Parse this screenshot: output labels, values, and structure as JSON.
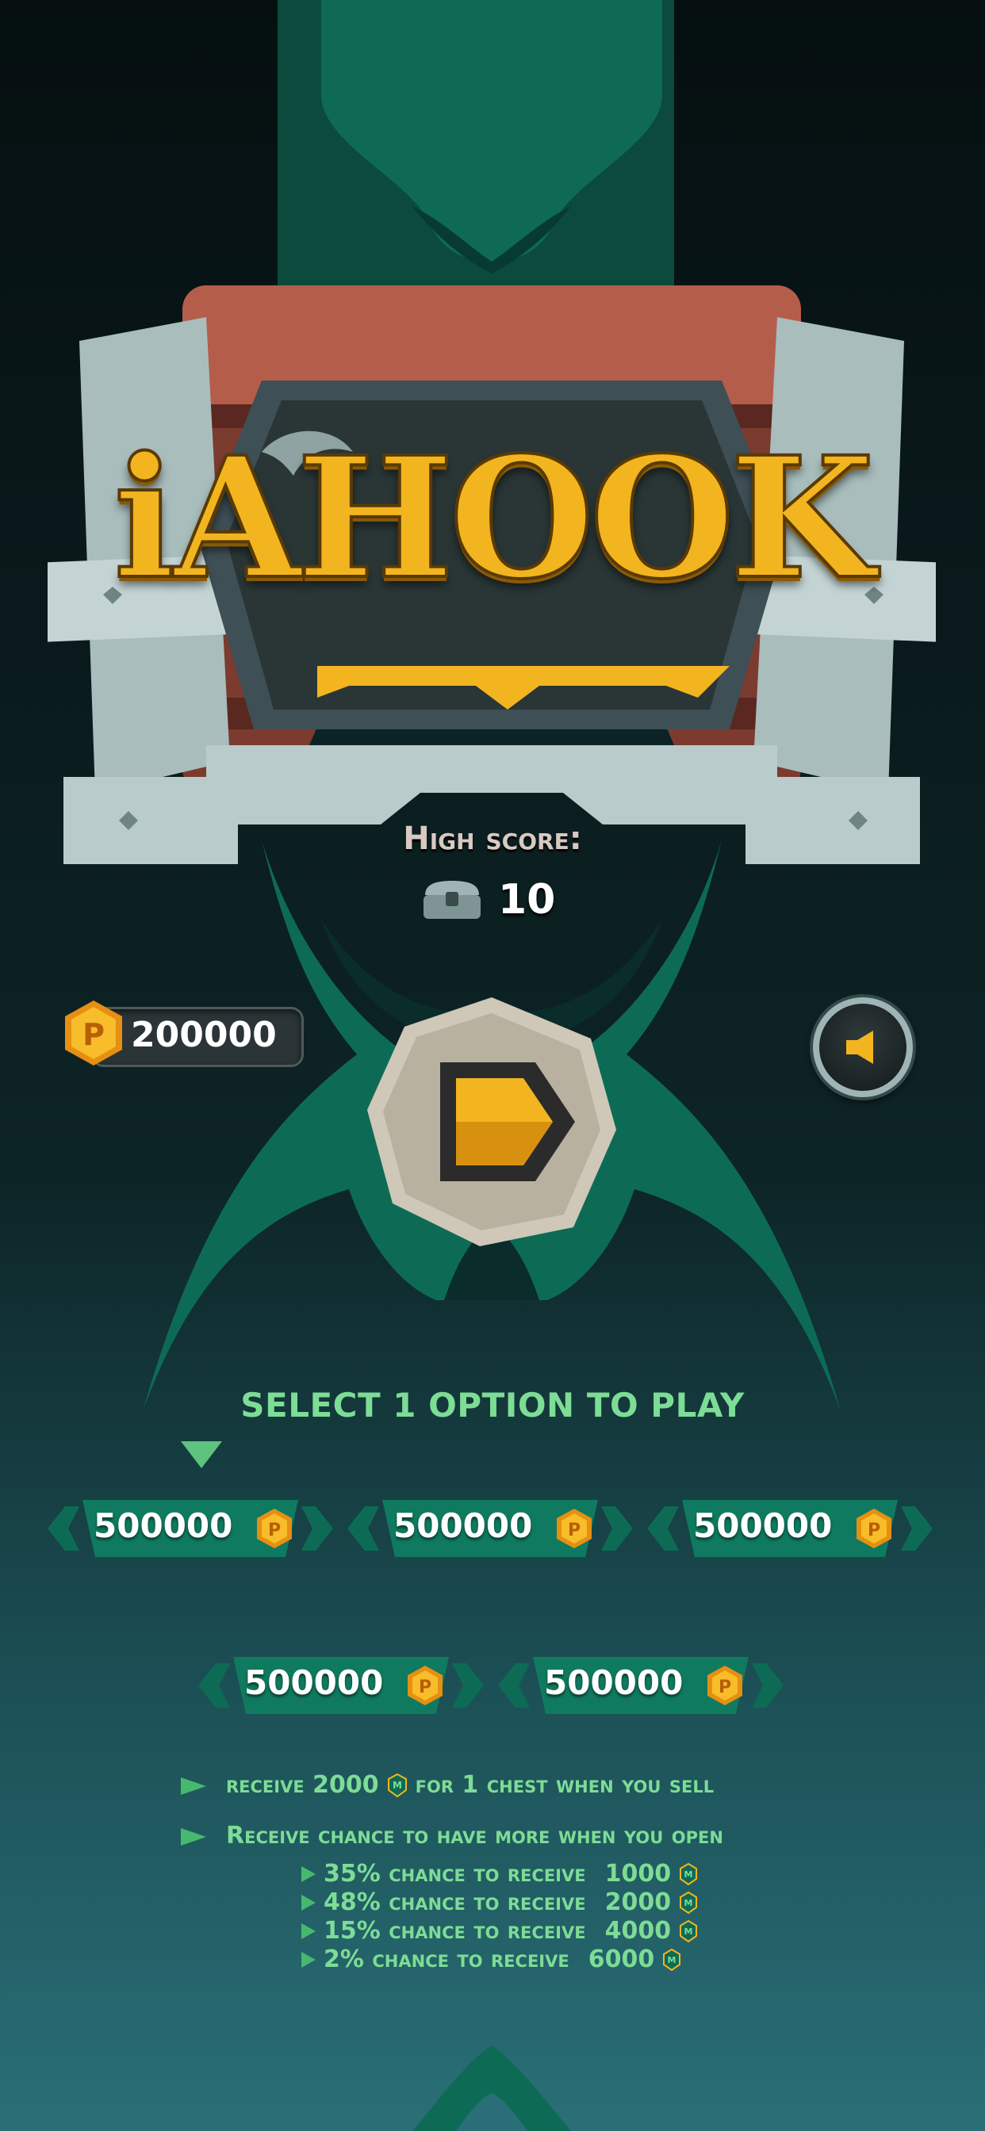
{
  "title": "iAHOOK",
  "high_score": {
    "label": "High score:",
    "value": "10"
  },
  "coins": {
    "balance": "200000"
  },
  "buttons": {
    "play": "play",
    "sound": "sound"
  },
  "select_prompt": "SELECT 1 OPTION TO PLAY",
  "options": [
    {
      "amount": "500000"
    },
    {
      "amount": "500000"
    },
    {
      "amount": "500000"
    },
    {
      "amount": "500000"
    },
    {
      "amount": "500000"
    }
  ],
  "info": {
    "sell_prefix": "receive 2000",
    "sell_suffix": "for 1 chest when you sell",
    "open_line": "Receive chance to have more when you open",
    "chances": [
      {
        "text": "35% chance to receive",
        "amount": "1000"
      },
      {
        "text": "48% chance to receive",
        "amount": "2000"
      },
      {
        "text": "15% chance to receive",
        "amount": "4000"
      },
      {
        "text": "2% chance to receive",
        "amount": "6000"
      }
    ]
  },
  "colors": {
    "accent_green": "#7ddc95",
    "emblem_green": "#0d6b55",
    "gold": "#f2b51f",
    "metal": "#b9c9c9"
  }
}
